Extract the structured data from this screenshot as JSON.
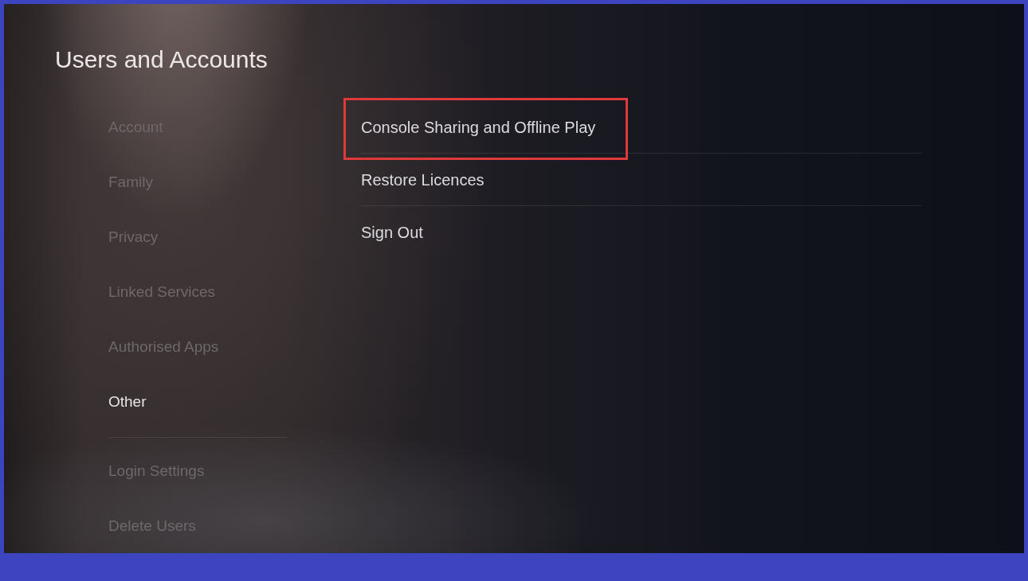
{
  "header": {
    "title": "Users and Accounts"
  },
  "sidebar": {
    "groups": [
      {
        "items": [
          {
            "label": "Account",
            "selected": false
          },
          {
            "label": "Family",
            "selected": false
          },
          {
            "label": "Privacy",
            "selected": false
          },
          {
            "label": "Linked Services",
            "selected": false
          },
          {
            "label": "Authorised Apps",
            "selected": false
          },
          {
            "label": "Other",
            "selected": true
          }
        ]
      },
      {
        "items": [
          {
            "label": "Login Settings",
            "selected": false
          },
          {
            "label": "Delete Users",
            "selected": false
          }
        ]
      }
    ]
  },
  "options": [
    {
      "label": "Console Sharing and Offline Play",
      "highlighted": true
    },
    {
      "label": "Restore Licences",
      "highlighted": false
    },
    {
      "label": "Sign Out",
      "highlighted": false
    }
  ]
}
